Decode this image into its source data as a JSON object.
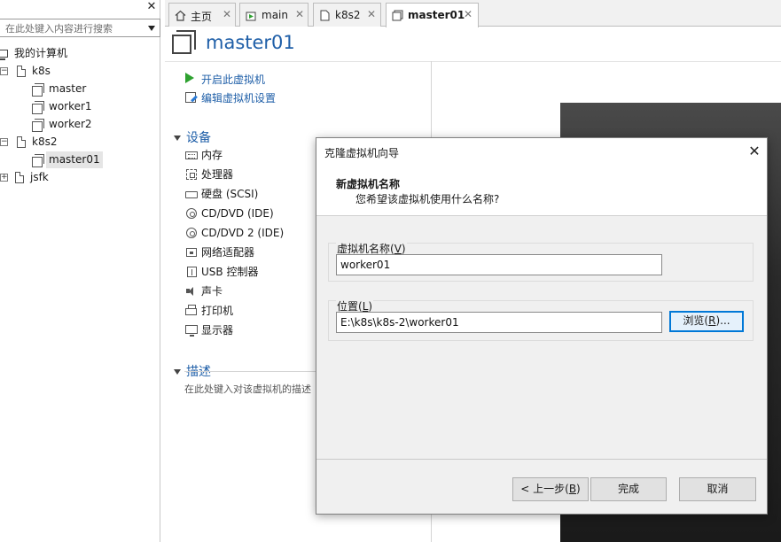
{
  "library": {
    "search_placeholder": "在此处键入内容进行搜索",
    "tree": [
      {
        "label": "我的计算机",
        "level": 0,
        "toggle": ""
      },
      {
        "label": "k8s",
        "level": 1,
        "toggle": "−"
      },
      {
        "label": "master",
        "level": 2,
        "toggle": ""
      },
      {
        "label": "worker1",
        "level": 2,
        "toggle": ""
      },
      {
        "label": "worker2",
        "level": 2,
        "toggle": ""
      },
      {
        "label": "k8s2",
        "level": 1,
        "toggle": "−"
      },
      {
        "label": "master01",
        "level": 2,
        "toggle": "",
        "selected": true
      },
      {
        "label": "jsfk",
        "level": 1,
        "toggle": "+"
      }
    ]
  },
  "tabs": [
    {
      "label": "主页",
      "icon": "home-icon"
    },
    {
      "label": "main",
      "icon": "vm-running-icon"
    },
    {
      "label": "k8s2",
      "icon": "folder-icon"
    },
    {
      "label": "master01",
      "icon": "vm-icon",
      "active": true
    }
  ],
  "vm": {
    "title": "master01",
    "commands": {
      "power_on": "开启此虚拟机",
      "edit_settings": "编辑虚拟机设置"
    },
    "devices_header": "设备",
    "devices": [
      {
        "label": "内存",
        "icon": "memory-icon"
      },
      {
        "label": "处理器",
        "icon": "cpu-icon"
      },
      {
        "label": "硬盘 (SCSI)",
        "icon": "disk-icon"
      },
      {
        "label": "CD/DVD (IDE)",
        "icon": "cd-icon"
      },
      {
        "label": "CD/DVD 2 (IDE)",
        "icon": "cd-icon"
      },
      {
        "label": "网络适配器",
        "icon": "network-icon"
      },
      {
        "label": "USB 控制器",
        "icon": "usb-icon"
      },
      {
        "label": "声卡",
        "icon": "sound-icon"
      },
      {
        "label": "打印机",
        "icon": "printer-icon"
      },
      {
        "label": "显示器",
        "icon": "monitor-icon"
      }
    ],
    "description_header": "描述",
    "description_placeholder": "在此处键入对该虚拟机的描述"
  },
  "dialog": {
    "title": "克隆虚拟机向导",
    "heading": "新虚拟机名称",
    "subheading": "您希望该虚拟机使用什么名称?",
    "name_label": "虚拟机名称(",
    "name_key": "V",
    "name_value": "worker01",
    "location_label": "位置(",
    "location_key": "L",
    "location_value": "E:\\k8s\\k8s-2\\worker01",
    "browse_label": "浏览(",
    "browse_key": "R",
    "browse_suffix": ")...",
    "back_label": "< 上一步(",
    "back_key": "B",
    "finish_label": "完成",
    "cancel_label": "取消"
  }
}
